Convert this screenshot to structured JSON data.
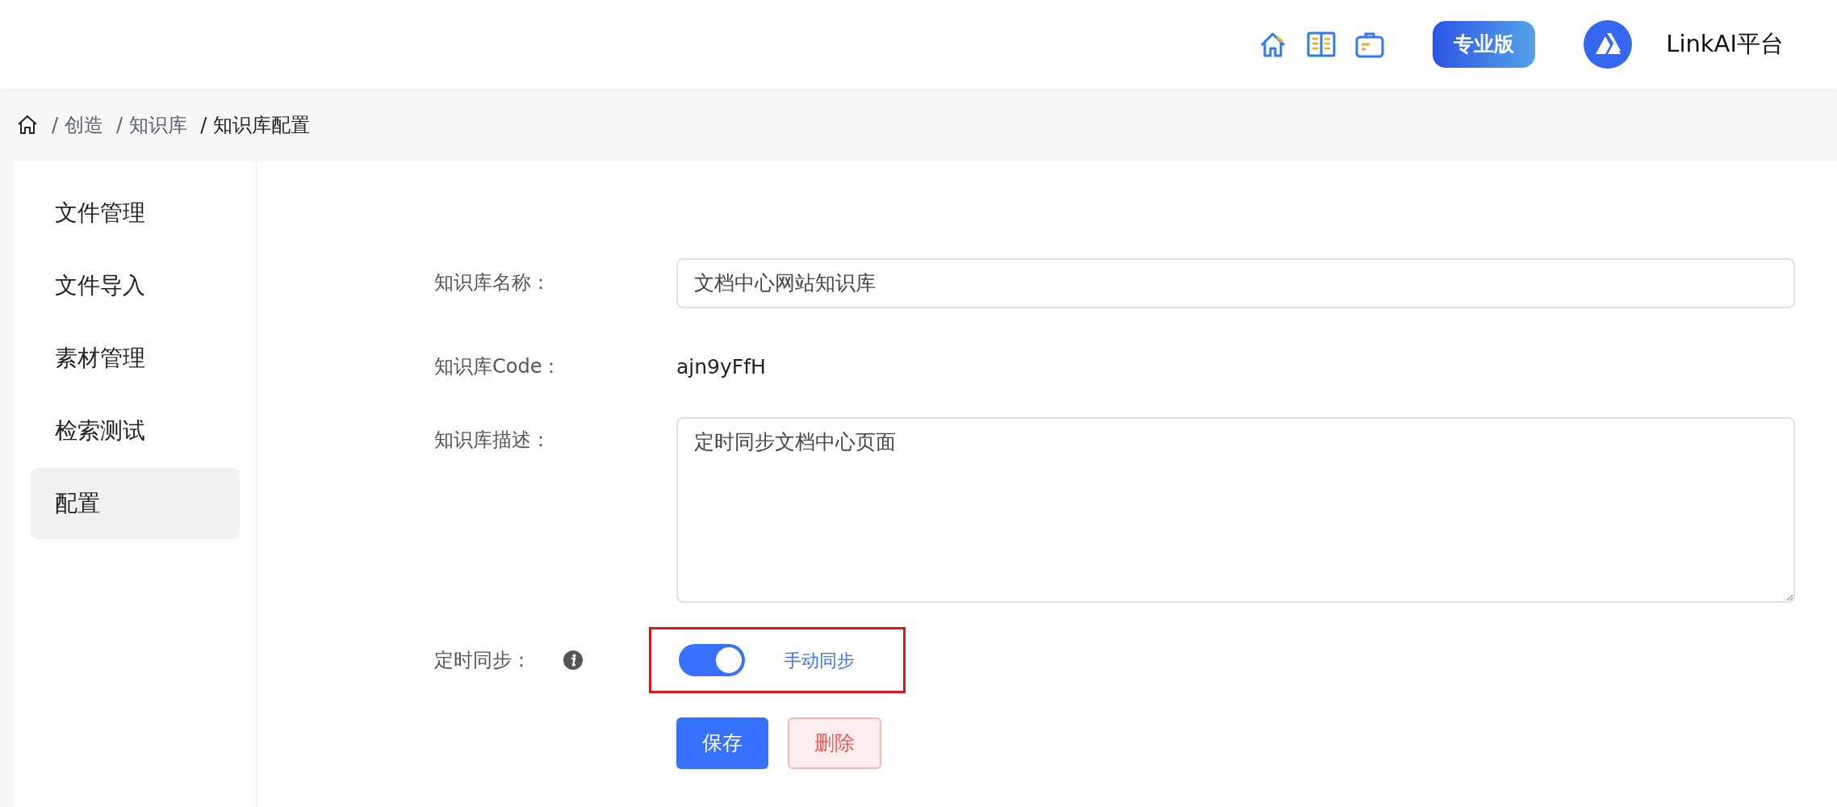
{
  "header": {
    "pro_badge": "专业版",
    "brand": "LinkAI平台"
  },
  "breadcrumb": [
    {
      "separator": "/",
      "label": "创造"
    },
    {
      "separator": "/",
      "label": "知识库"
    },
    {
      "separator": "/",
      "label": "知识库配置"
    }
  ],
  "sidebar": {
    "items": [
      {
        "label": "文件管理",
        "selected": false
      },
      {
        "label": "文件导入",
        "selected": false
      },
      {
        "label": "素材管理",
        "selected": false
      },
      {
        "label": "检索测试",
        "selected": false
      },
      {
        "label": "配置",
        "selected": true
      }
    ]
  },
  "form": {
    "name": {
      "label": "知识库名称：",
      "value": "文档中心网站知识库"
    },
    "code": {
      "label": "知识库Code：",
      "value": "ajn9yFfH"
    },
    "description": {
      "label": "知识库描述：",
      "value": "定时同步文档中心页面"
    },
    "sync": {
      "label": "定时同步：",
      "on": true,
      "link": "手动同步",
      "highlighted": true
    },
    "buttons": [
      {
        "label": "保存",
        "kind": "primary"
      },
      {
        "label": "删除",
        "kind": "danger"
      }
    ]
  }
}
